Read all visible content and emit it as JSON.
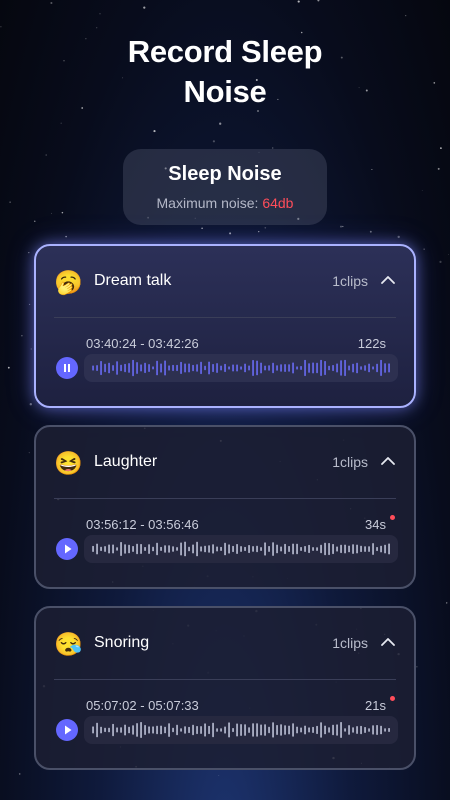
{
  "page_title": "Record Sleep\nNoise",
  "summary": {
    "title": "Sleep Noise",
    "label": "Maximum noise: ",
    "value": "64db",
    "value_color": "#ff4d5a"
  },
  "accent_color": "#6467ff",
  "cards": [
    {
      "icon": "sleep-talking-face-icon",
      "emoji": "🥱",
      "name": "Dream talk",
      "count": "1clips",
      "expanded": true,
      "time_range": "03:40:24 - 03:42:26",
      "duration": "122s",
      "playing": true,
      "new_dot": false
    },
    {
      "icon": "laughing-face-icon",
      "emoji": "😆",
      "name": "Laughter",
      "count": "1clips",
      "expanded": true,
      "time_range": "03:56:12 - 03:56:46",
      "duration": "34s",
      "playing": false,
      "new_dot": true
    },
    {
      "icon": "sleeping-face-icon",
      "emoji": "😪",
      "name": "Snoring",
      "count": "1clips",
      "expanded": true,
      "time_range": "05:07:02 - 05:07:33",
      "duration": "21s",
      "playing": false,
      "new_dot": true
    }
  ]
}
